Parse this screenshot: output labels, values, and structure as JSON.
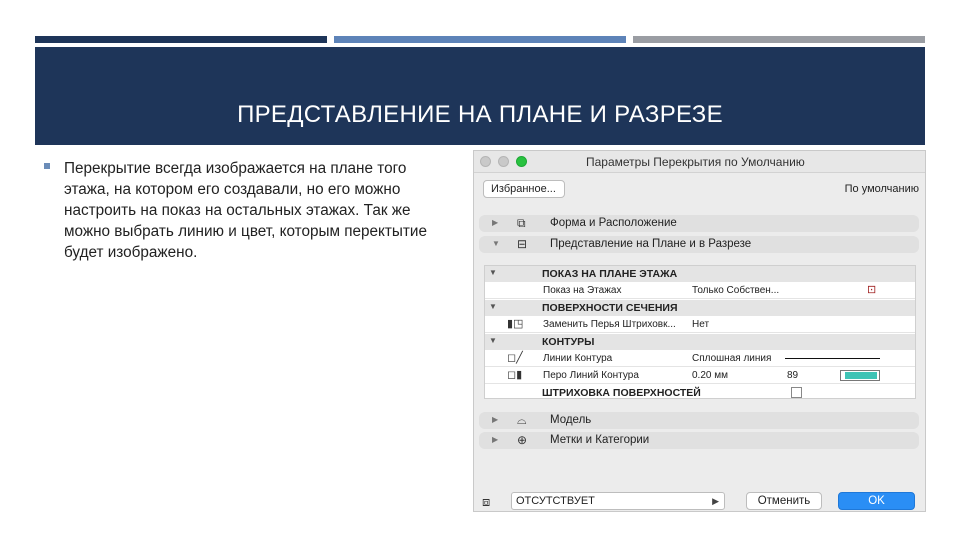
{
  "slide": {
    "title": "ПРЕДСТАВЛЕНИЕ НА ПЛАНЕ И РАЗРЕЗЕ",
    "bullet": "Перекрытие всегда изображается на плане того этажа, на котором его создавали, но его можно настроить на показ на остальных этажах. Так же можно выбрать линию и цвет, которым перектытие будет изображено."
  },
  "dialog": {
    "title": "Параметры Перекрытия по Умолчанию",
    "favorites_label": "Избранное...",
    "default_label": "По умолчанию",
    "sections": [
      {
        "label": "Форма и Расположение",
        "icon": "slab-shape-icon",
        "arrow": "▶"
      },
      {
        "label": "Представление на Плане и в Разрезе",
        "icon": "floorplan-icon",
        "arrow": "▼"
      },
      {
        "label": "Модель",
        "icon": "model-icon",
        "arrow": "▶"
      },
      {
        "label": "Метки и Категории",
        "icon": "tags-icon",
        "arrow": "▶"
      }
    ],
    "panel": {
      "group_show": "ПОКАЗ НА ПЛАНЕ ЭТАЖА",
      "show_on_floors_label": "Показ на Этажах",
      "show_on_floors_value": "Только Собствен...",
      "group_cut": "ПОВЕРХНОСТИ СЕЧЕНИЯ",
      "replace_pens_label": "Заменить Перья Штриховк...",
      "replace_pens_value": "Нет",
      "group_contours": "КОНТУРЫ",
      "contour_line_label": "Линии Контура",
      "contour_line_value": "Сплошная линия",
      "contour_pen_label": "Перо Линий Контура",
      "contour_pen_value": "0.20 мм",
      "contour_pen_number": "89",
      "group_hatch": "ШТРИХОВКА ПОВЕРХНОСТЕЙ"
    },
    "layer_value": "ОТСУТСТВУЕТ",
    "cancel_label": "Отменить",
    "ok_label": "OK",
    "colors": {
      "ok": "#2a8ef5",
      "pen_swatch": "#3fc3b5",
      "title_band": "#1e3559"
    }
  }
}
